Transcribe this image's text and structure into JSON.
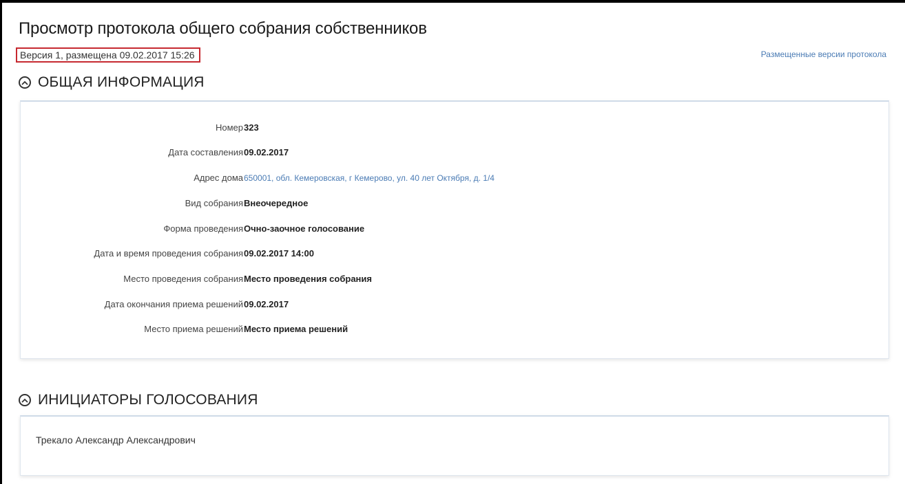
{
  "page": {
    "title": "Просмотр протокола общего собрания собственников",
    "version_info": "Версия 1, размещена 09.02.2017 15:26",
    "versions_link": "Размещенные версии протокола"
  },
  "general_info": {
    "section_title": "ОБЩАЯ ИНФОРМАЦИЯ",
    "rows": [
      {
        "label": "Номер",
        "value": "323"
      },
      {
        "label": "Дата составления",
        "value": "09.02.2017"
      },
      {
        "label": "Адрес дома",
        "value": "650001, обл. Кемеровская, г Кемерово, ул. 40 лет Октября, д. 1/4"
      },
      {
        "label": "Вид собрания",
        "value": "Внеочередное"
      },
      {
        "label": "Форма проведения",
        "value": "Очно-заочное голосование"
      },
      {
        "label": "Дата и время проведения собрания",
        "value": "09.02.2017 14:00"
      },
      {
        "label": "Место проведения собрания",
        "value": "Место проведения собрания"
      },
      {
        "label": "Дата окончания приема решений",
        "value": "09.02.2017"
      },
      {
        "label": "Место приема решений",
        "value": "Место приема решений"
      }
    ]
  },
  "initiators": {
    "section_title": "ИНИЦИАТОРЫ ГОЛОСОВАНИЯ",
    "items": [
      "Трекало Александр Александрович"
    ]
  },
  "icons": {
    "section_toggle": "chevron-up-circle-icon"
  },
  "colors": {
    "link": "#4a7bb4",
    "highlight_border": "#c6282f",
    "panel_border": "#cfdbe8"
  }
}
